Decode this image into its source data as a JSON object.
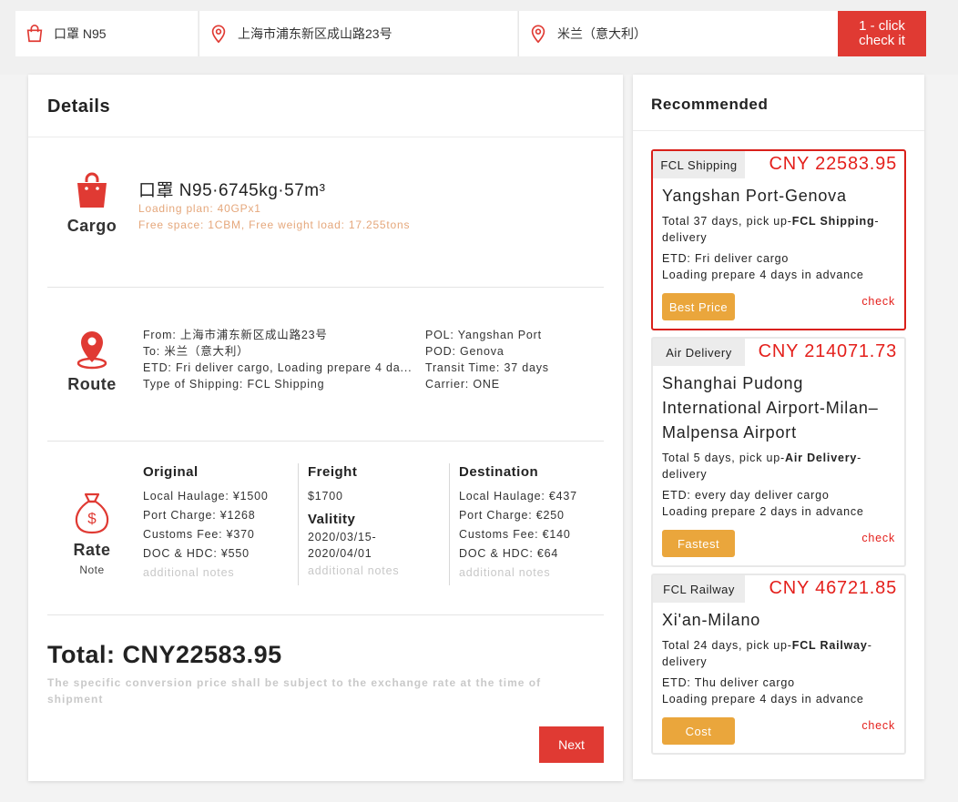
{
  "search": {
    "goods": "口罩 N95",
    "origin": "上海市浦东新区成山路23号",
    "destination": "米兰（意大利）",
    "button_label": "1 - click check it"
  },
  "details": {
    "title": "Details",
    "cargo": {
      "label": "Cargo",
      "title": "口罩 N95·6745kg·57m³",
      "loading_plan": "Loading plan: 40GPx1",
      "free_space": "Free space: 1CBM, Free weight load: 17.255tons"
    },
    "route": {
      "label": "Route",
      "from": "From: 上海市浦东新区成山路23号",
      "to": "To: 米兰（意大利）",
      "etd": "ETD: Fri deliver cargo, Loading prepare 4 da...",
      "type": "Type of Shipping: FCL Shipping",
      "pol": "POL: Yangshan Port",
      "pod": "POD: Genova",
      "transit": "Transit Time: 37 days",
      "carrier": "Carrier: ONE"
    },
    "rate": {
      "label": "Rate",
      "sublabel": "Note",
      "original": {
        "heading": "Original",
        "lines": [
          "Local Haulage: ¥1500",
          "Port Charge: ¥1268",
          "Customs Fee: ¥370",
          "DOC & HDC: ¥550"
        ],
        "notes": "additional notes"
      },
      "freight": {
        "heading": "Freight",
        "value": "$1700",
        "validity_heading": "Valitity",
        "validity_lines": [
          "2020/03/15-",
          "2020/04/01"
        ],
        "notes": "additional notes"
      },
      "destination": {
        "heading": "Destination",
        "lines": [
          "Local Haulage: €437",
          "Port Charge: €250",
          "Customs Fee: €140",
          "DOC & HDC: €64"
        ],
        "notes": "additional notes"
      }
    },
    "total": "Total: CNY22583.95",
    "disclaimer": "The specific conversion price shall be subject to the exchange rate at the time of shipment",
    "next_label": "Next"
  },
  "recommended": {
    "title": "Recommended",
    "cards": [
      {
        "tag": "FCL Shipping",
        "price": "CNY 22583.95",
        "route": "Yangshan Port-Genova",
        "desc_prefix": "Total 37 days, pick up-",
        "desc_mode": "FCL Shipping",
        "desc_suffix": "-delivery",
        "etd": "ETD: Fri deliver cargo",
        "prepare": "Loading prepare 4 days in advance",
        "badge": "Best Price",
        "check": "check"
      },
      {
        "tag": "Air Delivery",
        "price": "CNY 214071.73",
        "route": "Shanghai Pudong International Airport-Milan–Malpensa Airport",
        "desc_prefix": "Total 5 days, pick up-",
        "desc_mode": "Air Delivery",
        "desc_suffix": "-delivery",
        "etd": "ETD: every day deliver cargo",
        "prepare": "Loading prepare 2 days in advance",
        "badge": "Fastest",
        "check": "check"
      },
      {
        "tag": "FCL Railway",
        "price": "CNY 46721.85",
        "route": "Xi'an-Milano",
        "desc_prefix": "Total 24 days, pick up-",
        "desc_mode": "FCL Railway",
        "desc_suffix": "-delivery",
        "etd": "ETD: Thu deliver cargo",
        "prepare": "Loading prepare 4 days in advance",
        "badge": "Cost",
        "check": "check"
      }
    ]
  },
  "colors": {
    "accent_red": "#e03a33",
    "badge_orange": "#eaa63c",
    "price_red": "#e4201c",
    "note_orange": "#e5a77b"
  },
  "icons": [
    "shopping-bag-icon",
    "location-pin-icon",
    "money-bag-icon"
  ]
}
